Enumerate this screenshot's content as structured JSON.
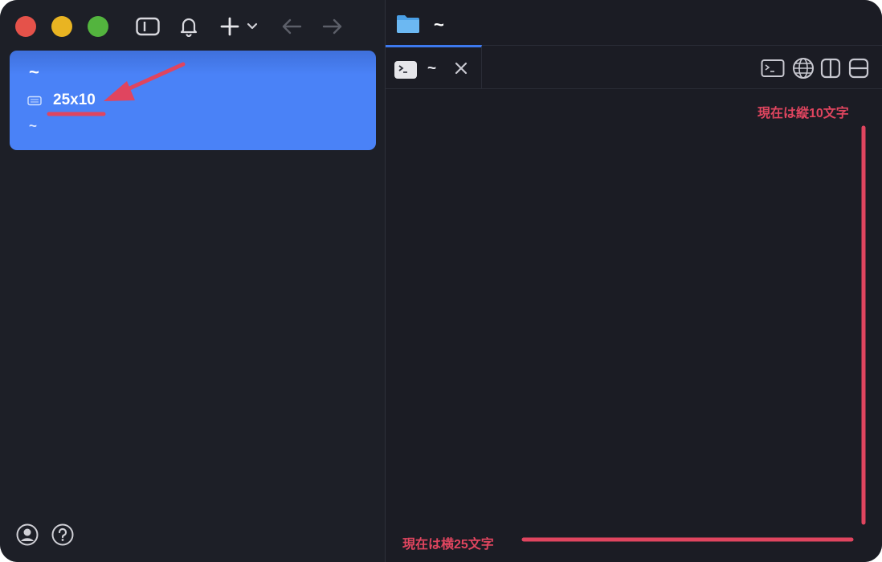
{
  "window": {
    "traffic_lights": [
      {
        "name": "close",
        "color": "#e5524a"
      },
      {
        "name": "minimize",
        "color": "#e9b422"
      },
      {
        "name": "maximize",
        "color": "#53b43e"
      }
    ]
  },
  "toolbar": {
    "icons": [
      "sidebar-toggle-icon",
      "bell-icon",
      "plus-icon",
      "chevron-down-icon",
      "arrow-left-icon",
      "arrow-right-icon"
    ]
  },
  "sidebar": {
    "session": {
      "title": "~",
      "size": "25x10",
      "path": "~",
      "accent_color": "#4a82f7"
    },
    "footer_icons": [
      "account-icon",
      "help-icon"
    ]
  },
  "main": {
    "header_title": "~",
    "tab": {
      "label": "~",
      "close": "✕"
    },
    "tools": [
      "terminal-icon",
      "globe-icon",
      "split-vertical-icon",
      "split-horizontal-icon"
    ]
  },
  "annotations": {
    "rows_label": "現在は縦10文字",
    "cols_label": "現在は横25文字",
    "color": "#e0455f"
  }
}
